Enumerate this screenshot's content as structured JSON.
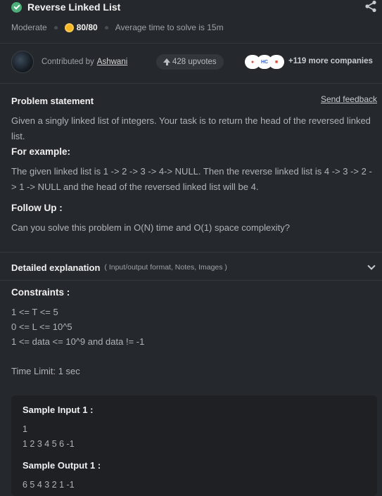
{
  "header": {
    "title": "Reverse Linked List",
    "difficulty": "Moderate",
    "score": "80/80",
    "avg_time": "Average time to solve is 15m"
  },
  "contributor": {
    "prefix": "Contributed by",
    "name": "Ashwani",
    "upvotes": "428 upvotes",
    "more_companies": "+119 more companies"
  },
  "problem": {
    "title": "Problem statement",
    "feedback": "Send feedback",
    "intro": "Given a singly linked list of integers. Your task is to return the head of the reversed linked list.",
    "example_head": "For example:",
    "example_text": "The given linked list is 1 -> 2 -> 3 -> 4-> NULL. Then the reverse linked list is 4 -> 3 -> 2 -> 1 -> NULL and the head of the reversed linked list will be 4.",
    "followup_head": "Follow Up :",
    "followup_text": "Can you solve this problem in O(N) time and O(1) space complexity?"
  },
  "detail": {
    "title": "Detailed explanation",
    "subtitle": "( Input/output format, Notes, Images )"
  },
  "constraints": {
    "title": "Constraints :",
    "lines": [
      "1 <= T <= 5",
      "0 <= L <= 10^5",
      "1 <= data <= 10^9 and data != -1"
    ],
    "time_limit": "Time Limit: 1 sec"
  },
  "sample": {
    "input_head": "Sample Input 1 :",
    "input_lines": [
      "1",
      "1 2 3 4 5 6 -1"
    ],
    "output_head": "Sample Output 1 :",
    "output_lines": [
      "6 5 4 3 2 1 -1"
    ]
  },
  "colors": {
    "background": "#25282c",
    "success": "#4caf7a",
    "coin": "#f5b623"
  }
}
